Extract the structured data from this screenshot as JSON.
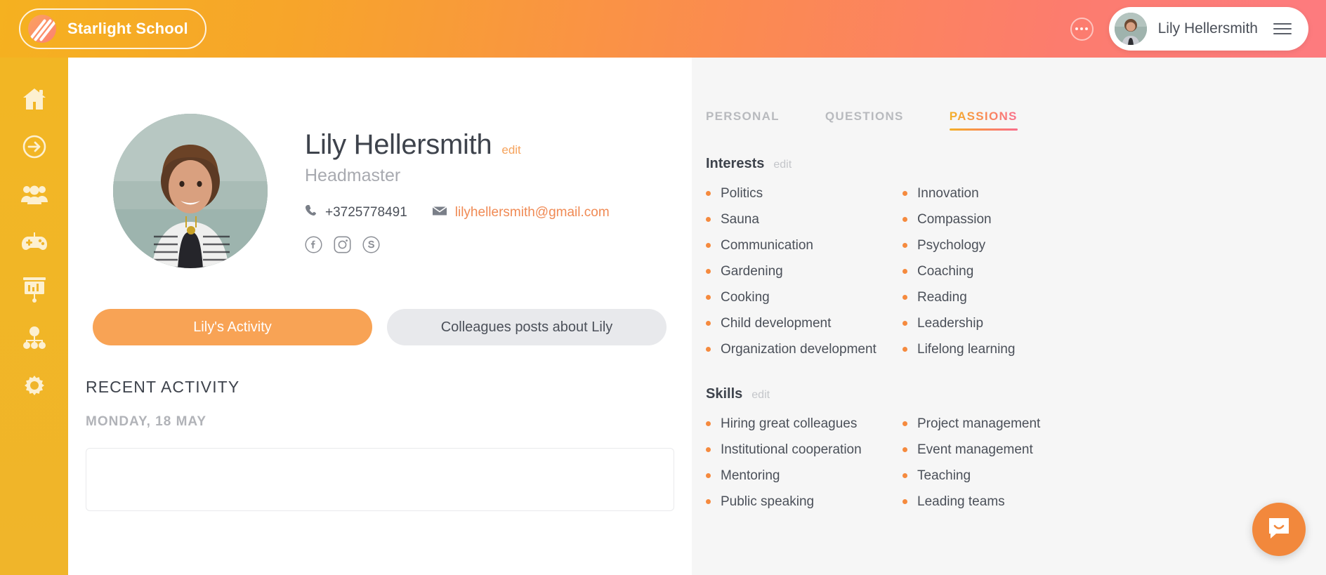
{
  "topbar": {
    "brand_name": "Starlight School",
    "brand_logo_icon": "slash-stripes-logo-icon",
    "more_icon": "more-dots-icon",
    "user_name": "Lily Hellersmith",
    "avatar_icon": "user-avatar",
    "menu_icon": "hamburger-menu-icon"
  },
  "sidebar": {
    "items": [
      {
        "icon": "home-icon",
        "name": "sidebar-item-home"
      },
      {
        "icon": "arrow-circle-icon",
        "name": "sidebar-item-onboarding"
      },
      {
        "icon": "people-group-icon",
        "name": "sidebar-item-people"
      },
      {
        "icon": "gamepad-icon",
        "name": "sidebar-item-games"
      },
      {
        "icon": "presentation-chart-icon",
        "name": "sidebar-item-reports"
      },
      {
        "icon": "org-chart-icon",
        "name": "sidebar-item-structure"
      },
      {
        "icon": "gear-icon",
        "name": "sidebar-item-settings"
      }
    ]
  },
  "profile": {
    "name": "Lily Hellersmith",
    "edit_label": "edit",
    "role": "Headmaster",
    "phone": "+3725778491",
    "email": "lilyhellersmith@gmail.com",
    "phone_icon": "phone-icon",
    "email_icon": "envelope-icon",
    "socials": [
      {
        "icon": "facebook-icon",
        "name": "social-link-facebook"
      },
      {
        "icon": "instagram-icon",
        "name": "social-link-instagram"
      },
      {
        "icon": "skype-icon",
        "name": "social-link-skype"
      }
    ]
  },
  "activity_buttons": {
    "primary": "Lily's Activity",
    "secondary": "Colleagues posts about Lily"
  },
  "recent_activity": {
    "title": "RECENT ACTIVITY",
    "date": "MONDAY, 18 MAY"
  },
  "right_panel": {
    "tabs": [
      {
        "label": "PERSONAL",
        "active": false
      },
      {
        "label": "QUESTIONS",
        "active": false
      },
      {
        "label": "PASSIONS",
        "active": true
      }
    ],
    "interests": {
      "title": "Interests",
      "edit_label": "edit",
      "items": [
        "Politics",
        "Innovation",
        "Sauna",
        "Compassion",
        "Communication",
        "Psychology",
        "Gardening",
        "Coaching",
        "Cooking",
        "Reading",
        "Child development",
        "Leadership",
        "Organization development",
        "Lifelong learning"
      ]
    },
    "skills": {
      "title": "Skills",
      "edit_label": "edit",
      "items": [
        "Hiring great colleagues",
        "Project management",
        "Institutional cooperation",
        "Event management",
        "Mentoring",
        "Teaching",
        "Public speaking",
        "Leading teams"
      ]
    }
  },
  "chat": {
    "icon": "chat-bubble-icon"
  },
  "colors": {
    "brand_yellow": "#f2b624",
    "brand_orange": "#f8a355",
    "brand_pink": "#fd7b7f",
    "bullet_orange": "#f58a3e",
    "panel_bg": "#f6f6f6",
    "text_dark": "#3e434c",
    "text_muted": "#a8aab0"
  }
}
